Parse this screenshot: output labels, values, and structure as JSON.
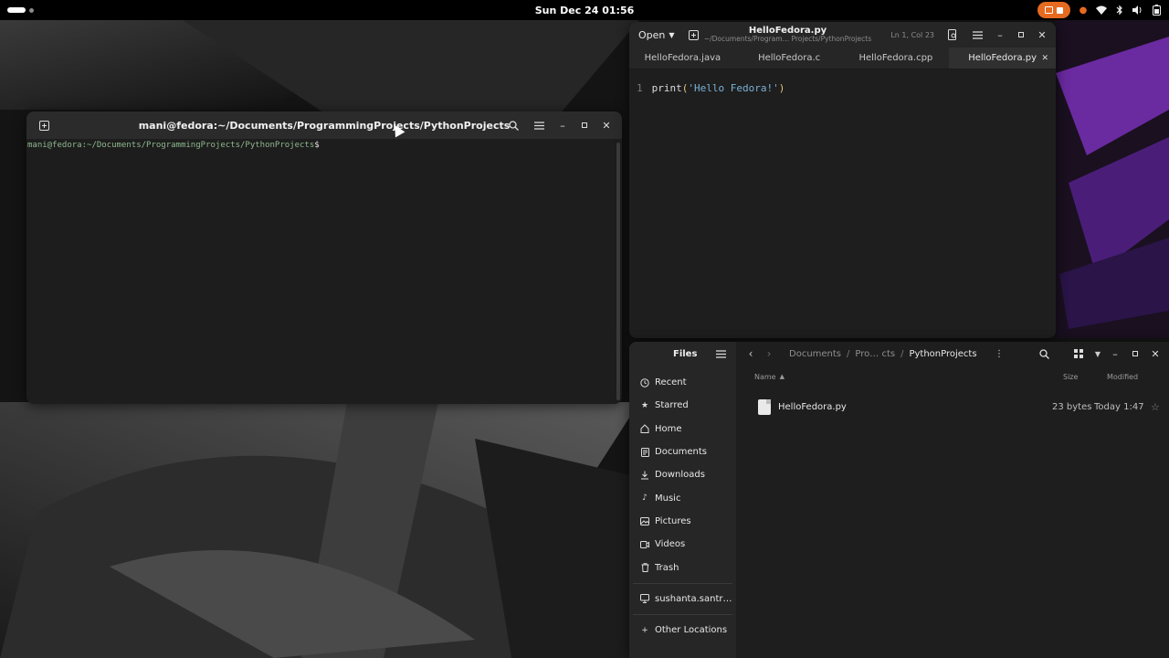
{
  "topbar": {
    "clock": "Sun Dec 24  01:56",
    "icons": [
      "screen-record-icon",
      "stop-recording-icon",
      "privacy-indicator-icon",
      "wifi-icon",
      "bluetooth-icon",
      "volume-icon",
      "battery-icon"
    ]
  },
  "terminal": {
    "title": "mani@fedora:~/Documents/ProgrammingProjects/PythonProjects",
    "prompt": "mani@fedora:~/Documents/ProgrammingProjects/PythonProjects",
    "prompt_symbol": "$"
  },
  "editor": {
    "open_label": "Open",
    "title": "HelloFedora.py",
    "path": "~/Documents/Program… Projects/PythonProjects",
    "cursor_position": "Ln 1, Col 23",
    "tabs": [
      {
        "label": "HelloFedora.java"
      },
      {
        "label": "HelloFedora.c"
      },
      {
        "label": "HelloFedora.cpp"
      },
      {
        "label": "HelloFedora.py",
        "active": true
      }
    ],
    "line_number": "1",
    "code_fn": "print",
    "code_open": "(",
    "code_str": "'Hello Fedora!'",
    "code_close": ")"
  },
  "files": {
    "title": "Files",
    "places": [
      {
        "label": "Recent",
        "icon": "clock-icon"
      },
      {
        "label": "Starred",
        "icon": "star-icon"
      },
      {
        "label": "Home",
        "icon": "home-icon"
      },
      {
        "label": "Documents",
        "icon": "document-icon"
      },
      {
        "label": "Downloads",
        "icon": "download-icon"
      },
      {
        "label": "Music",
        "icon": "music-icon"
      },
      {
        "label": "Pictures",
        "icon": "picture-icon"
      },
      {
        "label": "Videos",
        "icon": "video-icon"
      },
      {
        "label": "Trash",
        "icon": "trash-icon"
      }
    ],
    "network": "sushanta.santr…",
    "other_locations": "Other Locations",
    "path": {
      "p1": "Documents",
      "p2": "Pro… cts",
      "current": "PythonProjects"
    },
    "columns": {
      "name": "Name",
      "size": "Size",
      "modified": "Modified"
    },
    "rows": [
      {
        "name": "HelloFedora.py",
        "size": "23 bytes",
        "modified": "Today 1:47"
      }
    ]
  }
}
